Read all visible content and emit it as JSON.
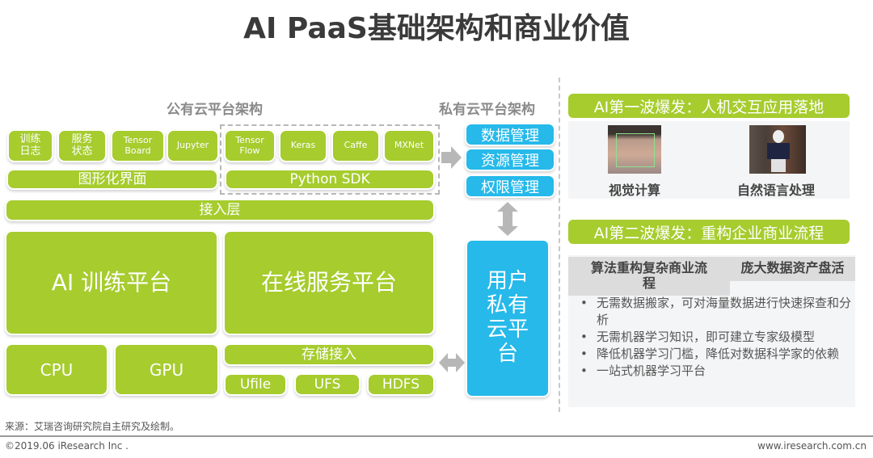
{
  "title": "AI PaaS基础架构和商业价值",
  "public_cloud": {
    "label": "公有云平台架构",
    "tools": [
      "训练\n日志",
      "服务\n状态",
      "Tensor\nBoard",
      "Jupyter"
    ],
    "frameworks": [
      "Tensor\nFlow",
      "Keras",
      "Caffe",
      "MXNet"
    ],
    "gui": "图形化界面",
    "sdk": "Python SDK",
    "access_layer": "接入层",
    "training_platform": "AI 训练平台",
    "serving_platform": "在线服务平台",
    "cpu": "CPU",
    "gpu": "GPU",
    "storage_access": "存储接入",
    "storage": [
      "Ufile",
      "UFS",
      "HDFS"
    ]
  },
  "private_cloud": {
    "label": "私有云平台架构",
    "modules": [
      "数据管理",
      "资源管理",
      "权限管理"
    ],
    "user_platform": "用户\n私有\n云平\n台"
  },
  "wave1": {
    "header": "AI第一波爆发：人机交互应用落地",
    "items": [
      {
        "caption": "视觉计算",
        "image": "face-recognition-photo"
      },
      {
        "caption": "自然语言处理",
        "image": "robot-photo"
      }
    ]
  },
  "wave2": {
    "header": "AI第二波爆发：重构企业商业流程",
    "sub_left": "算法重构复杂商业流\n程",
    "sub_right": "庞大数据资产盘活",
    "bullets": [
      "无需数据搬家，可对海量数据进行快速探查和分析",
      "无需机器学习知识，即可建立专家级模型",
      "降低机器学习门槛，降低对数据科学家的依赖",
      "一站式机器学习平台"
    ]
  },
  "colors": {
    "green": "#a6cc2e",
    "blue": "#26b9ea",
    "gray_text": "#8a8a8a"
  },
  "footer": {
    "source": "来源：艾瑞咨询研究院自主研究及绘制。",
    "copyright": "©2019.06 iResearch Inc .",
    "website": "www.iresearch.com.cn"
  }
}
